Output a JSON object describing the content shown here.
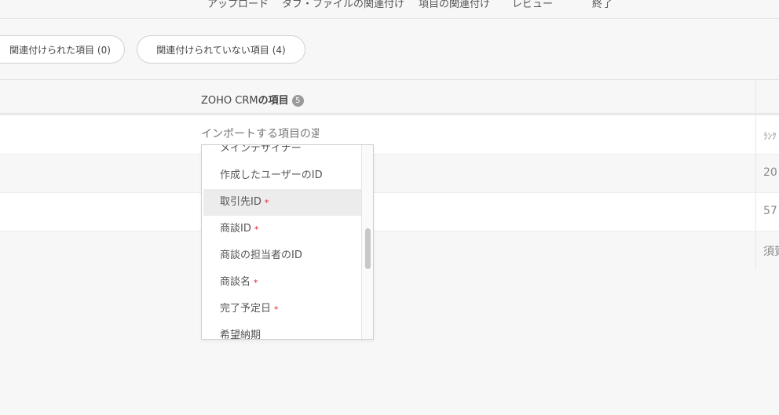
{
  "stepper": {
    "steps": [
      "アップロード",
      "タブ・ファイルの関連付け",
      "項目の関連付け",
      "レビュー",
      "終了"
    ]
  },
  "tabs": {
    "mapped": "関連付けられた項目 (0)",
    "unmapped": "関連付けられていない項目 (4)"
  },
  "table": {
    "header": {
      "title_prefix": "ZOHO CRM",
      "title_suffix": "の項目",
      "count": "5"
    },
    "field_placeholder": "インポートする項目の選択",
    "right_column": [
      "ﾗﾝｸ",
      "20",
      "57",
      "須賀"
    ]
  },
  "dropdown": {
    "items": [
      {
        "label": "メインデザイナー",
        "required": false
      },
      {
        "label": "作成したユーザーのID",
        "required": false
      },
      {
        "label": "取引先ID",
        "required": true
      },
      {
        "label": "商談ID",
        "required": true
      },
      {
        "label": "商談の担当者のID",
        "required": false
      },
      {
        "label": "商談名",
        "required": true
      },
      {
        "label": "完了予定日",
        "required": true
      },
      {
        "label": "希望納期",
        "required": false
      }
    ],
    "required_mark": "*"
  }
}
